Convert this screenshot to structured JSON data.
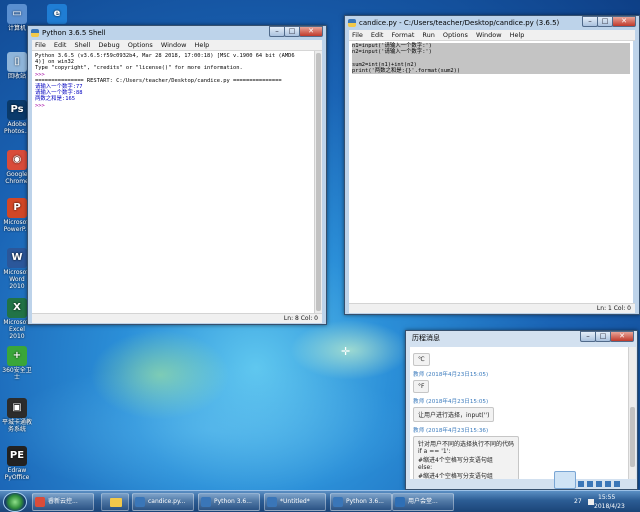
{
  "desktop_icons": [
    {
      "label": "计算机",
      "color": "#5a8fd0",
      "glyph": "▭"
    },
    {
      "label": "回收站",
      "color": "#8fb5da",
      "glyph": "▯"
    },
    {
      "label": "Adobe Photos...",
      "color": "#0a3a6b",
      "glyph": "Ps"
    },
    {
      "label": "Google Chrome",
      "color": "#d94c3a",
      "glyph": "◉"
    },
    {
      "label": "Microsoft PowerP...",
      "color": "#d24726",
      "glyph": "P"
    },
    {
      "label": "Microsoft Word 2010",
      "color": "#2b579a",
      "glyph": "W"
    },
    {
      "label": "Microsoft Excel 2010",
      "color": "#217346",
      "glyph": "X"
    },
    {
      "label": "360安全卫士",
      "color": "#3aa63a",
      "glyph": "+"
    },
    {
      "label": "平城卡通教务系统",
      "color": "#2c2c2c",
      "glyph": "▣"
    },
    {
      "label": "Edraw PyOffice",
      "color": "#222222",
      "glyph": "PE"
    }
  ],
  "shell": {
    "title": "Python 3.6.5 Shell",
    "menus": [
      "File",
      "Edit",
      "Shell",
      "Debug",
      "Options",
      "Window",
      "Help"
    ],
    "lines": [
      "Python 3.6.5 (v3.6.5:f59c0932b4, Mar 28 2018, 17:00:18) [MSC v.1900 64 bit (AMD6",
      "4)] on win32",
      "Type \"copyright\", \"credits\" or \"license()\" for more information.",
      ">>> ",
      "=============== RESTART: C:/Users/teacher/Desktop/candice.py ===============",
      "请输入一个数字:77",
      "请输入一个数字:88",
      "两数之和是:165",
      ">>> "
    ],
    "status": "Ln: 8   Col: 0"
  },
  "editor": {
    "title": "candice.py - C:/Users/teacher/Desktop/candice.py (3.6.5)",
    "menus": [
      "File",
      "Edit",
      "Format",
      "Run",
      "Options",
      "Window",
      "Help"
    ],
    "lines": [
      "n1=input('请输入一个数字:')",
      "n2=input('请输入一个数字:')",
      "",
      "sum2=int(n1)+int(n2)",
      "print('两数之和是:{}'.format(sum2))"
    ],
    "status": "Ln: 1   Col: 0"
  },
  "chat": {
    "title": "历程消息",
    "messages": [
      {
        "meta": "",
        "text": "℃"
      },
      {
        "meta": "教师 (2018年4月23日15:05)",
        "text": "°F"
      },
      {
        "meta": "教师 (2018年4月23日15:05)",
        "text": "让用户进行选择，input('')"
      },
      {
        "meta": "教师 (2018年4月23日15:36)",
        "text": "针对用户不同的选择执行不同的代码\nif a == '1':\n#缩进4个空格写分支语句组\nelse:\n#缩进4个空格写分支语句组"
      }
    ]
  },
  "taskbar": {
    "items": [
      {
        "label": "睿新云控..."
      },
      {
        "label": "candice.py..."
      },
      {
        "label": "Python 3.6..."
      },
      {
        "label": "*Untitled*"
      },
      {
        "label": "Python 3.6..."
      },
      {
        "label": "用户会堂..."
      }
    ],
    "clock_time": "15:55",
    "clock_date": "2018/4/23"
  }
}
